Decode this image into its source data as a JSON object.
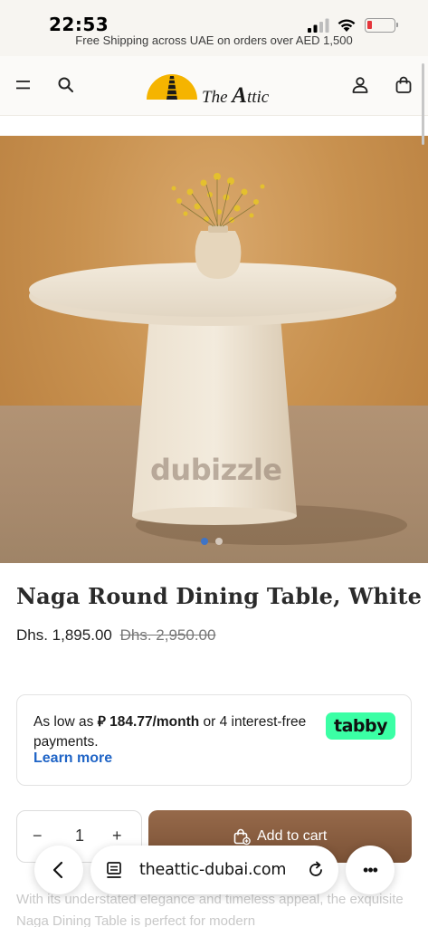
{
  "status_bar": {
    "time": "22:53"
  },
  "announcement": "Free Shipping across UAE on orders over AED 1,500",
  "header": {
    "logo_text_1": "The ",
    "logo_text_2": "A",
    "logo_text_3": "ttic"
  },
  "hero": {
    "watermark": "dubizzle",
    "slide_count": 2,
    "active_slide": 1
  },
  "product": {
    "title": "Naga Round Dining Table, White",
    "price": "Dhs. 1,895.00",
    "compare_price": "Dhs. 2,950.00"
  },
  "tabby": {
    "text_prefix": "As low as ",
    "amount": "⃃ 184.77/month",
    "text_suffix": " or 4 interest-free payments.",
    "learn_more": "Learn more",
    "badge": "tabby"
  },
  "quantity": {
    "minus": "−",
    "value": "1",
    "plus": "+"
  },
  "cart": {
    "label": "Add to cart"
  },
  "description": "With its understated elegance and timeless appeal, the exquisite Naga Dining Table is perfect for modern",
  "browser": {
    "url": "theattic-dubai.com",
    "more": "•••"
  },
  "colors": {
    "cart_button": "#7b5236",
    "tabby_green": "#3bffa5",
    "link_blue": "#1f64c6",
    "logo_yellow": "#f5b400"
  }
}
